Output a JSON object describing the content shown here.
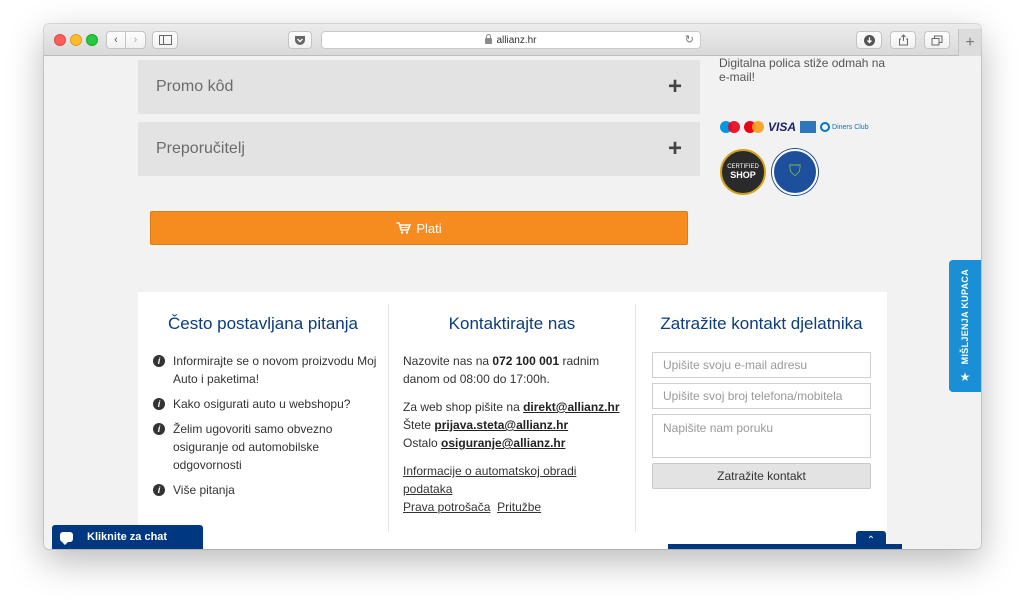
{
  "browser": {
    "url": "allianz.hr"
  },
  "checkout": {
    "promo_label": "Promo kôd",
    "referrer_label": "Preporučitelj",
    "expand_symbol": "+",
    "pay_label": "Plati"
  },
  "aside": {
    "policy_note": "Digitalna polica stiže odmah na e-mail!",
    "cards": [
      "Maestro",
      "MasterCard",
      "VISA",
      "American Express",
      "Diners Club"
    ],
    "visa_text": "VISA",
    "diners_text": "Diners Club",
    "badge_certified_top": "CERTIFIED",
    "badge_certified_main": "SHOP",
    "badge_trust": "European Trust Mark EMOTA"
  },
  "faq": {
    "title": "Često postavljana pitanja",
    "items": [
      "Informirajte se o novom proizvodu Moj Auto i paketima!",
      "Kako osigurati auto u webshopu?",
      "Želim ugovoriti samo obvezno osiguranje od automobilske odgovornosti",
      "Više pitanja"
    ]
  },
  "contact": {
    "title": "Kontaktirajte nas",
    "call_prefix": "Nazovite nas na",
    "phone": "072 100 001",
    "call_suffix": "radnim danom od 08:00 do 17:00h.",
    "webshop_prefix": "Za web shop pišite na",
    "webshop_email": "direkt@allianz.hr",
    "claims_prefix": "Štete",
    "claims_email": "prijava.steta@allianz.hr",
    "other_prefix": "Ostalo",
    "other_email": "osiguranje@allianz.hr",
    "link_data_processing": "Informacije o automatskoj obradi podataka",
    "link_consumer_rights": "Prava potrošača",
    "link_complaints": "Pritužbe"
  },
  "request_contact": {
    "title": "Zatražite kontakt djelatnika",
    "email_placeholder": "Upišite svoju e-mail adresu",
    "phone_placeholder": "Upišite svoj broj telefona/mobitela",
    "message_placeholder": "Napišite nam poruku",
    "submit_label": "Zatražite kontakt"
  },
  "widgets": {
    "chat_label": "Kliknite za chat",
    "reviews_label": "MIŠLJENJA KUPACA"
  },
  "colors": {
    "brand_blue": "#003781",
    "accent_orange": "#f68b1f",
    "reviews_blue": "#1a8fd6"
  }
}
